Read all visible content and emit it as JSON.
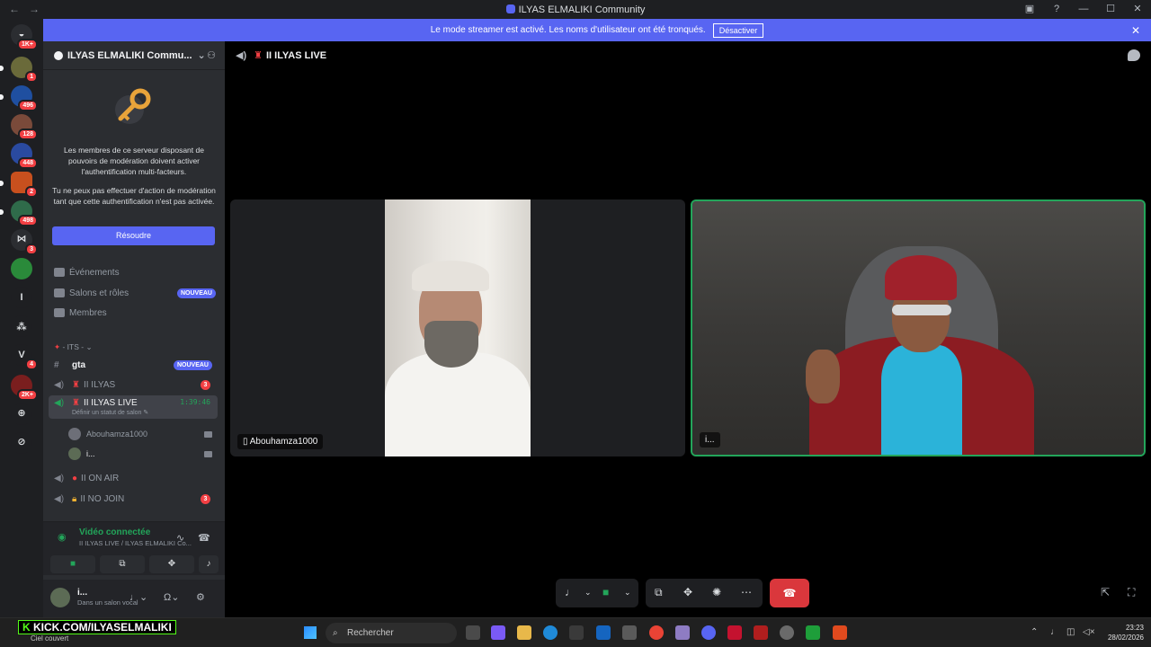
{
  "window": {
    "title": "ILYAS ELMALIKI Community",
    "nav_back": "←",
    "nav_forward": "→",
    "controls": {
      "minimize": "—",
      "maximize": "☐",
      "close": "✕",
      "help": "?",
      "inbox": "▣"
    }
  },
  "servers": [
    {
      "badge": "1K+"
    },
    {
      "badge": "1"
    },
    {
      "badge": "496"
    },
    {
      "badge": "128"
    },
    {
      "badge": "448"
    },
    {
      "badge": "2"
    },
    {
      "badge": "498"
    },
    {
      "badge": "3"
    },
    {
      "badge": ""
    },
    {
      "glyph": "I"
    },
    {
      "glyph": "⁂"
    },
    {
      "glyph": "V",
      "badge": "4"
    },
    {
      "badge": "2K+"
    }
  ],
  "notice": {
    "text": "Le mode streamer est activé. Les noms d'utilisateur ont été tronqués.",
    "button": "Désactiver",
    "close": "✕"
  },
  "sidebar": {
    "server_name": "ILYAS ELMALIKI Commu...",
    "mfa_text_1": "Les membres de ce serveur disposant de pouvoirs de modération doivent activer l'authentification multi-facteurs.",
    "mfa_text_2": "Tu ne peux pas effectuer d'action de modération tant que cette authentification n'est pas activée.",
    "resolve_button": "Résoudre",
    "menu": [
      {
        "label": "Événements",
        "badge": ""
      },
      {
        "label": "Salons et rôles",
        "badge": "NOUVEAU"
      },
      {
        "label": "Membres",
        "badge": ""
      }
    ],
    "category": "- ITS -",
    "channels": {
      "gta": {
        "label": "gta",
        "badge": "NOUVEAU"
      },
      "ilyas": {
        "label": "II ILYAS",
        "count": "3"
      },
      "ilyas_live": {
        "label": "II ILYAS LIVE",
        "timer": "1:39:46",
        "status": "Définir un statut de salon ✎"
      },
      "on_air": {
        "label": "II ON AIR"
      },
      "no_join": {
        "label": "II NO JOIN",
        "count": "3"
      }
    },
    "voice_users": [
      {
        "name": "Abouhamza1000"
      },
      {
        "name": "i..."
      }
    ]
  },
  "voice_panel": {
    "status": "Vidéo connectée",
    "channel": "II ILYAS LIVE / ILYAS ELMALIKI Co..."
  },
  "user_panel": {
    "name": "i...",
    "status": "Dans un salon vocal"
  },
  "stage": {
    "channel_title": "II ILYAS LIVE",
    "tiles": [
      {
        "name": "Abouhamza1000"
      },
      {
        "name": "i..."
      }
    ]
  },
  "taskbar": {
    "kick_prefix": "K",
    "kick_text": "KICK.COM/ILYASELMALIKI",
    "weather": "Ciel couvert",
    "search_placeholder": "Rechercher",
    "time": "23:23",
    "date": "28/02/2026"
  },
  "colors": {
    "accent": "#5865f2",
    "online": "#23a55a",
    "danger": "#da373c",
    "badge": "#f23f43"
  }
}
